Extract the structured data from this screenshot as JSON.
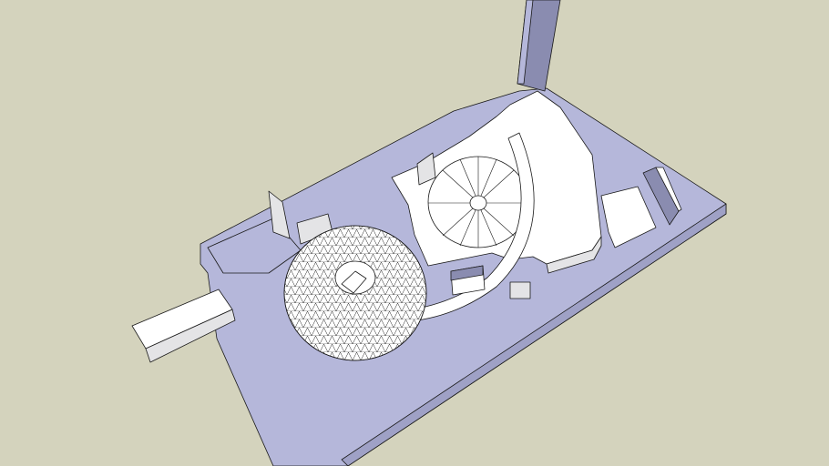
{
  "viewport": {
    "background_color": "#d4d3bd",
    "ground_color": "#b5b7da",
    "building_color": "#ffffff",
    "shadow_face_color": "#e4e4e6",
    "dark_face_color": "#8a8cb0",
    "edge_color": "#1a1a1a"
  }
}
